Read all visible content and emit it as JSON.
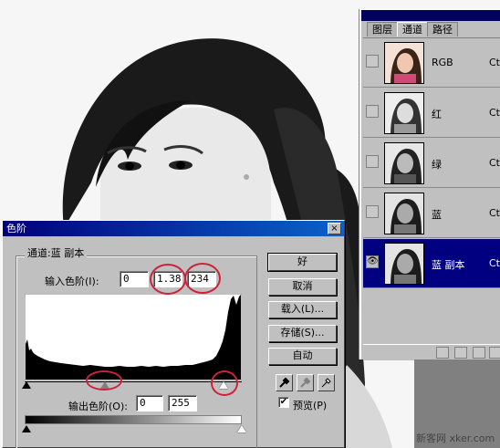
{
  "palette": {
    "tabs": [
      {
        "label": "图层",
        "active": false
      },
      {
        "label": "通道",
        "active": true
      },
      {
        "label": "路径",
        "active": false
      }
    ],
    "channels": [
      {
        "name": "RGB",
        "shortcut": "Ctr",
        "visible": false,
        "selected": false
      },
      {
        "name": "红",
        "shortcut": "Ctr",
        "visible": false,
        "selected": false
      },
      {
        "name": "绿",
        "shortcut": "Ctr",
        "visible": false,
        "selected": false
      },
      {
        "name": "蓝",
        "shortcut": "Ctr",
        "visible": false,
        "selected": false
      },
      {
        "name": "蓝 副本",
        "shortcut": "Ctr",
        "visible": true,
        "selected": true
      }
    ],
    "eye_glyph": "👁"
  },
  "dialog": {
    "title": "色阶",
    "close_glyph": "×",
    "channel_label": "通道:蓝 副本",
    "input_levels_label": "输入色阶(I):",
    "input_levels": {
      "black": "0",
      "gamma": "1.38",
      "white": "234"
    },
    "output_levels_label": "输出色阶(O):",
    "output_levels": {
      "black": "0",
      "white": "255"
    },
    "buttons": {
      "ok": "好",
      "cancel": "取消",
      "load": "载入(L)...",
      "save": "存储(S)...",
      "auto": "自动"
    },
    "preview_label": "预览(P)",
    "preview_checked": true,
    "check_glyph": "✔"
  },
  "colors": {
    "selection": "#000080",
    "title_bar": "#00007b",
    "annotation": "#d0203a"
  },
  "watermark": "新客网 xker.com"
}
